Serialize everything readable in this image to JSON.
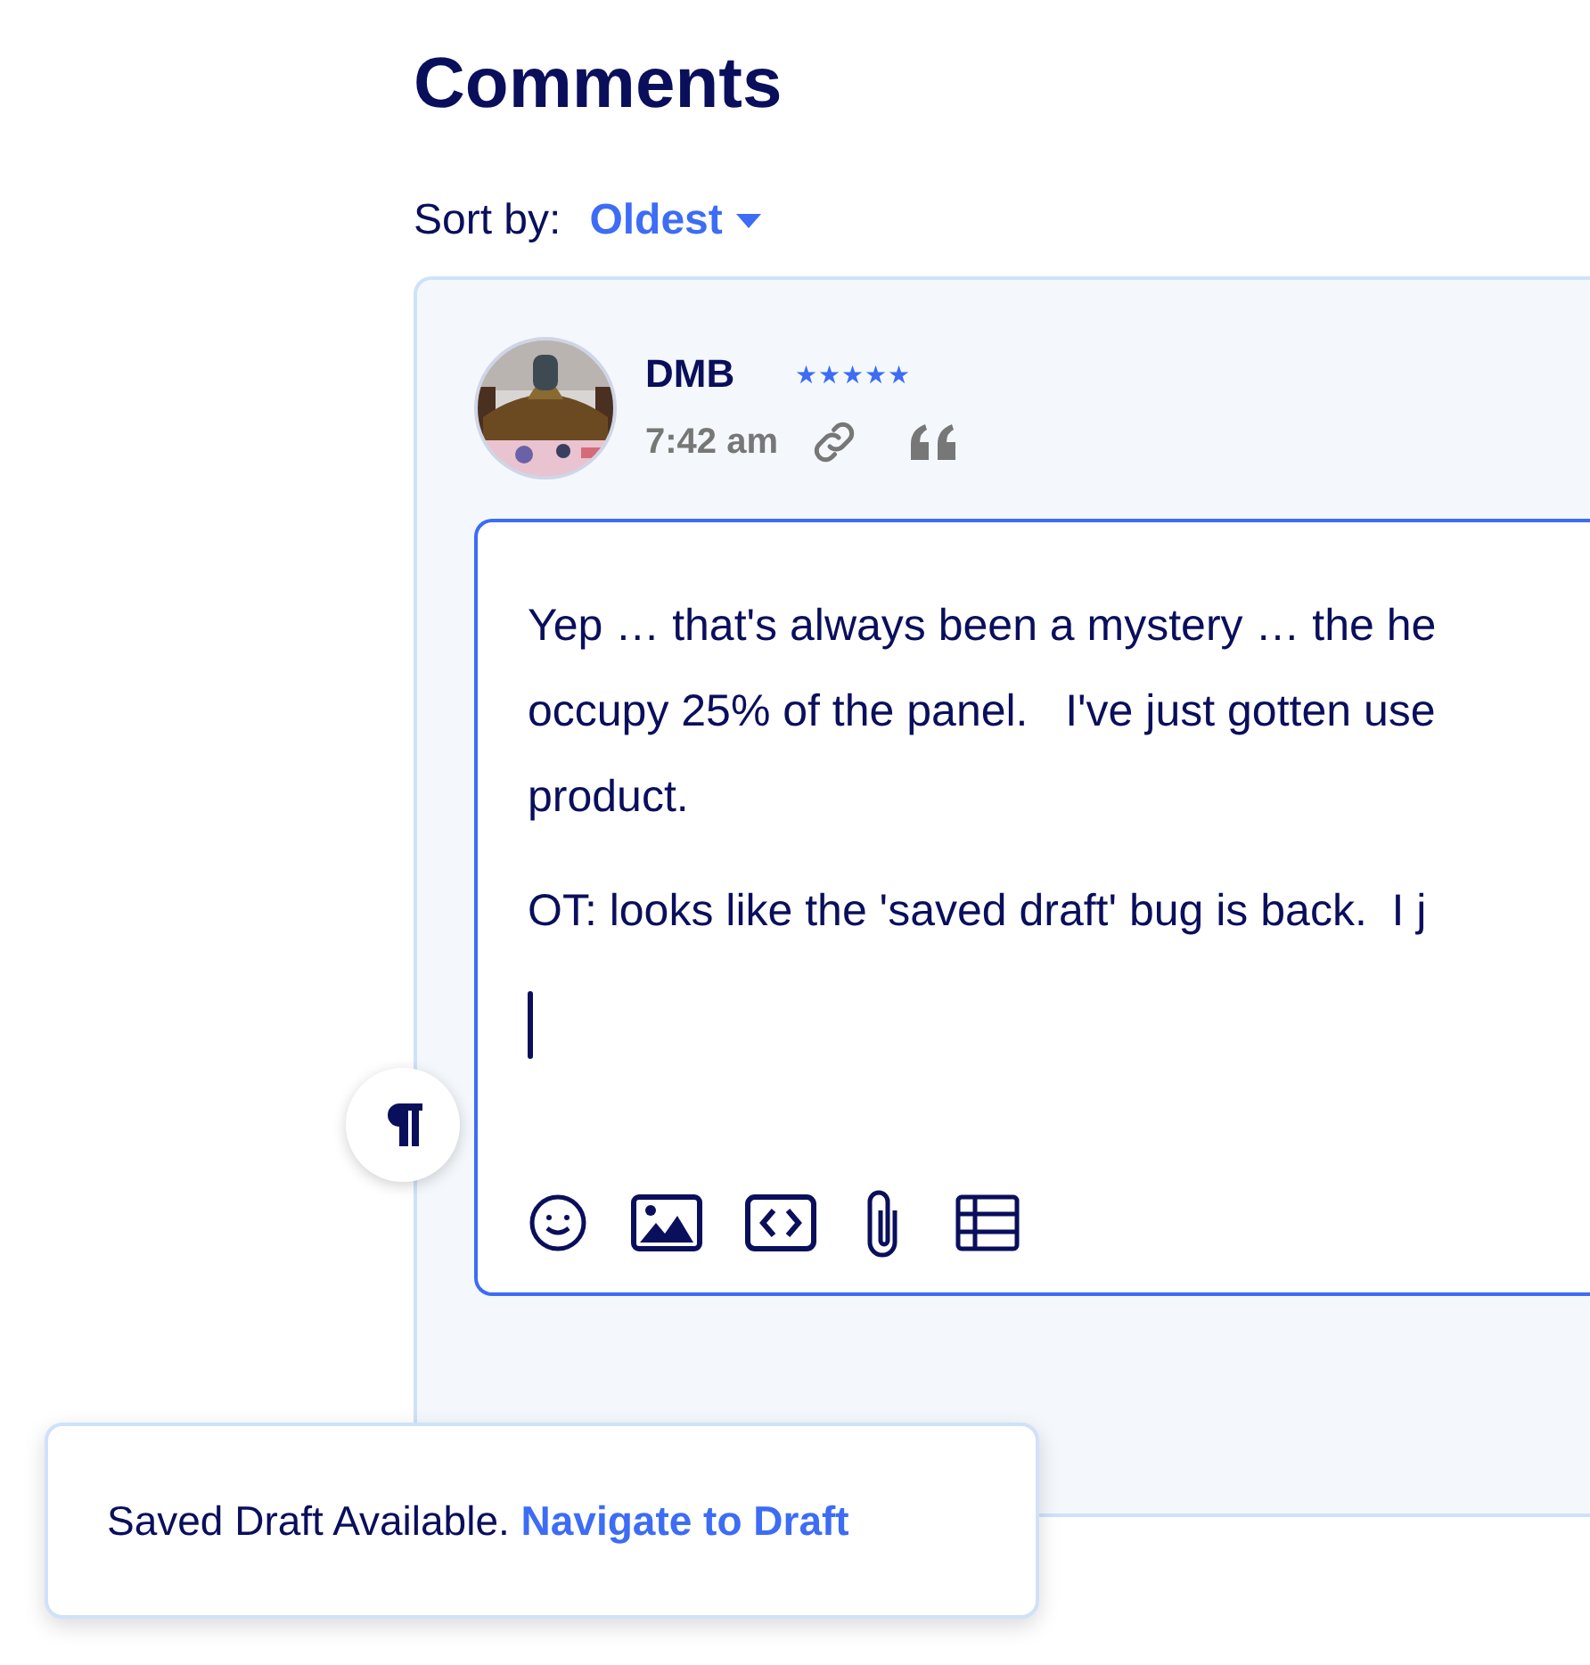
{
  "heading": "Comments",
  "sort": {
    "label": "Sort by:",
    "value": "Oldest"
  },
  "comment": {
    "author": "DMB",
    "stars": 5,
    "time": "7:42 am",
    "editor": {
      "paragraphs": [
        [
          "Yep … that's always been a mystery … the he",
          "occupy 25% of the panel.   I've just gotten use",
          "product."
        ],
        [
          "OT: looks like the 'saved draft' bug is back.  I j"
        ]
      ]
    }
  },
  "toast": {
    "text": "Saved Draft Available.",
    "link": "Navigate to Draft"
  }
}
